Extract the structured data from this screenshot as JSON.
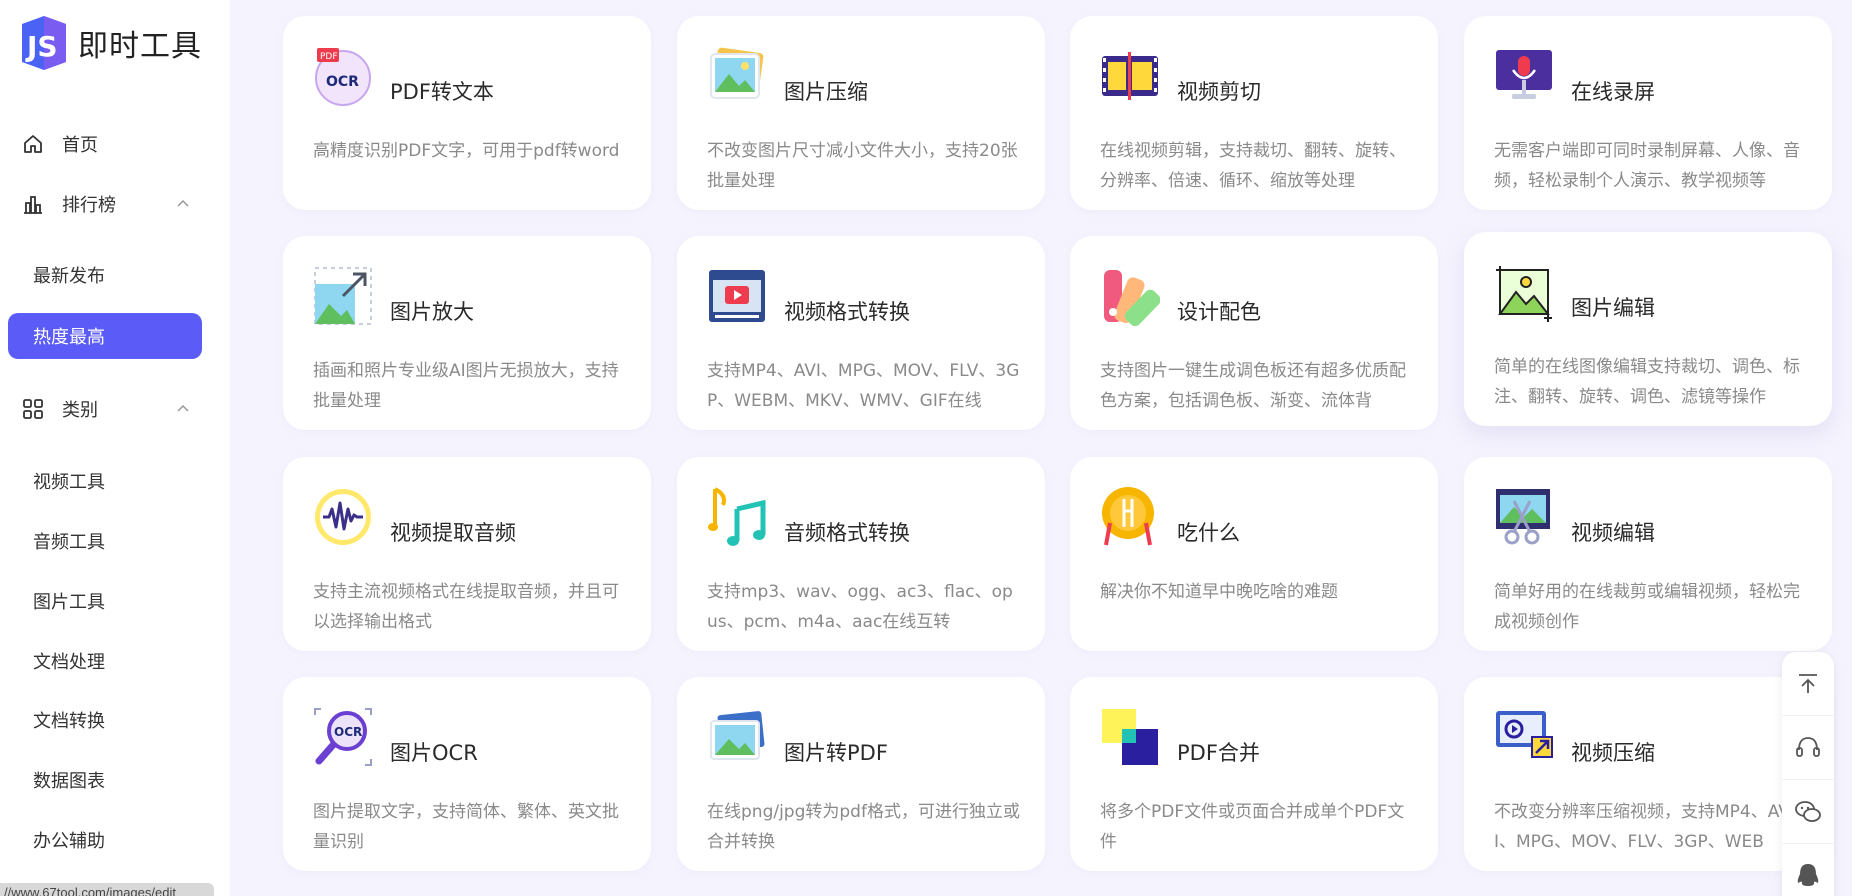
{
  "logo": {
    "text": "即时工具",
    "icon": "logo-js-icon"
  },
  "nav": {
    "home": {
      "label": "首页",
      "icon": "home-icon"
    },
    "ranking": {
      "label": "排行榜",
      "icon": "bar-chart-icon",
      "expanded": true,
      "items": [
        "最新发布",
        "热度最高"
      ],
      "active": "热度最高"
    },
    "category": {
      "label": "类别",
      "icon": "grid-icon",
      "expanded": true,
      "items": [
        "视频工具",
        "音频工具",
        "图片工具",
        "文档处理",
        "文档转换",
        "数据图表",
        "办公辅助"
      ]
    }
  },
  "status_url": "//www.67tool.com/images/edit",
  "cards": [
    {
      "title": "PDF转文本",
      "desc": "高精度识别PDF文字，可用于pdf转word",
      "icon": "pdf-ocr-icon"
    },
    {
      "title": "图片压缩",
      "desc": "不改变图片尺寸减小文件大小，支持20张批量处理",
      "icon": "image-compress-icon"
    },
    {
      "title": "视频剪切",
      "desc": "在线视频剪辑，支持裁切、翻转、旋转、分辨率、倍速、循环、缩放等处理",
      "icon": "film-cut-icon"
    },
    {
      "title": "在线录屏",
      "desc": "无需客户端即可同时录制屏幕、人像、音频，轻松录制个人演示、教学视频等",
      "icon": "screen-record-icon"
    },
    {
      "title": "图片放大",
      "desc": "插画和照片专业级AI图片无损放大，支持批量处理",
      "icon": "image-enlarge-icon"
    },
    {
      "title": "视频格式转换",
      "desc": "支持MP4、AVI、MPG、MOV、FLV、3GP、WEBM、MKV、WMV、GIF在线",
      "icon": "video-convert-icon"
    },
    {
      "title": "设计配色",
      "desc": "支持图片一键生成调色板还有超多优质配色方案，包括调色板、渐变、流体背",
      "icon": "palette-icon"
    },
    {
      "title": "图片编辑",
      "desc": "简单的在线图像编辑支持裁切、调色、标注、翻转、旋转、调色、滤镜等操作",
      "icon": "image-edit-icon"
    },
    {
      "title": "视频提取音频",
      "desc": "支持主流视频格式在线提取音频，并且可以选择输出格式",
      "icon": "audio-wave-icon"
    },
    {
      "title": "音频格式转换",
      "desc": "支持mp3、wav、ogg、ac3、flac、opus、pcm、m4a、aac在线互转",
      "icon": "music-note-icon"
    },
    {
      "title": "吃什么",
      "desc": "解决你不知道早中晚吃啥的难题",
      "icon": "food-icon"
    },
    {
      "title": "视频编辑",
      "desc": "简单好用的在线裁剪或编辑视频，轻松完成视频创作",
      "icon": "video-edit-icon"
    },
    {
      "title": "图片OCR",
      "desc": "图片提取文字，支持简体、繁体、英文批量识别",
      "icon": "image-ocr-icon"
    },
    {
      "title": "图片转PDF",
      "desc": "在线png/jpg转为pdf格式，可进行独立或合并转换",
      "icon": "image-to-pdf-icon"
    },
    {
      "title": "PDF合并",
      "desc": "将多个PDF文件或页面合并成单个PDF文件",
      "icon": "pdf-merge-icon"
    },
    {
      "title": "视频压缩",
      "desc": "不改变分辨率压缩视频，支持MP4、AVI、MPG、MOV、FLV、3GP、WEB",
      "icon": "video-compress-icon"
    }
  ],
  "float_tools": [
    {
      "name": "back-to-top",
      "icon": "arrow-up-icon"
    },
    {
      "name": "customer-service",
      "icon": "headset-icon"
    },
    {
      "name": "wechat",
      "icon": "wechat-icon"
    },
    {
      "name": "qq",
      "icon": "qq-icon"
    }
  ],
  "colors": {
    "accent": "#5b5bf7",
    "background": "#f5f3fd"
  }
}
